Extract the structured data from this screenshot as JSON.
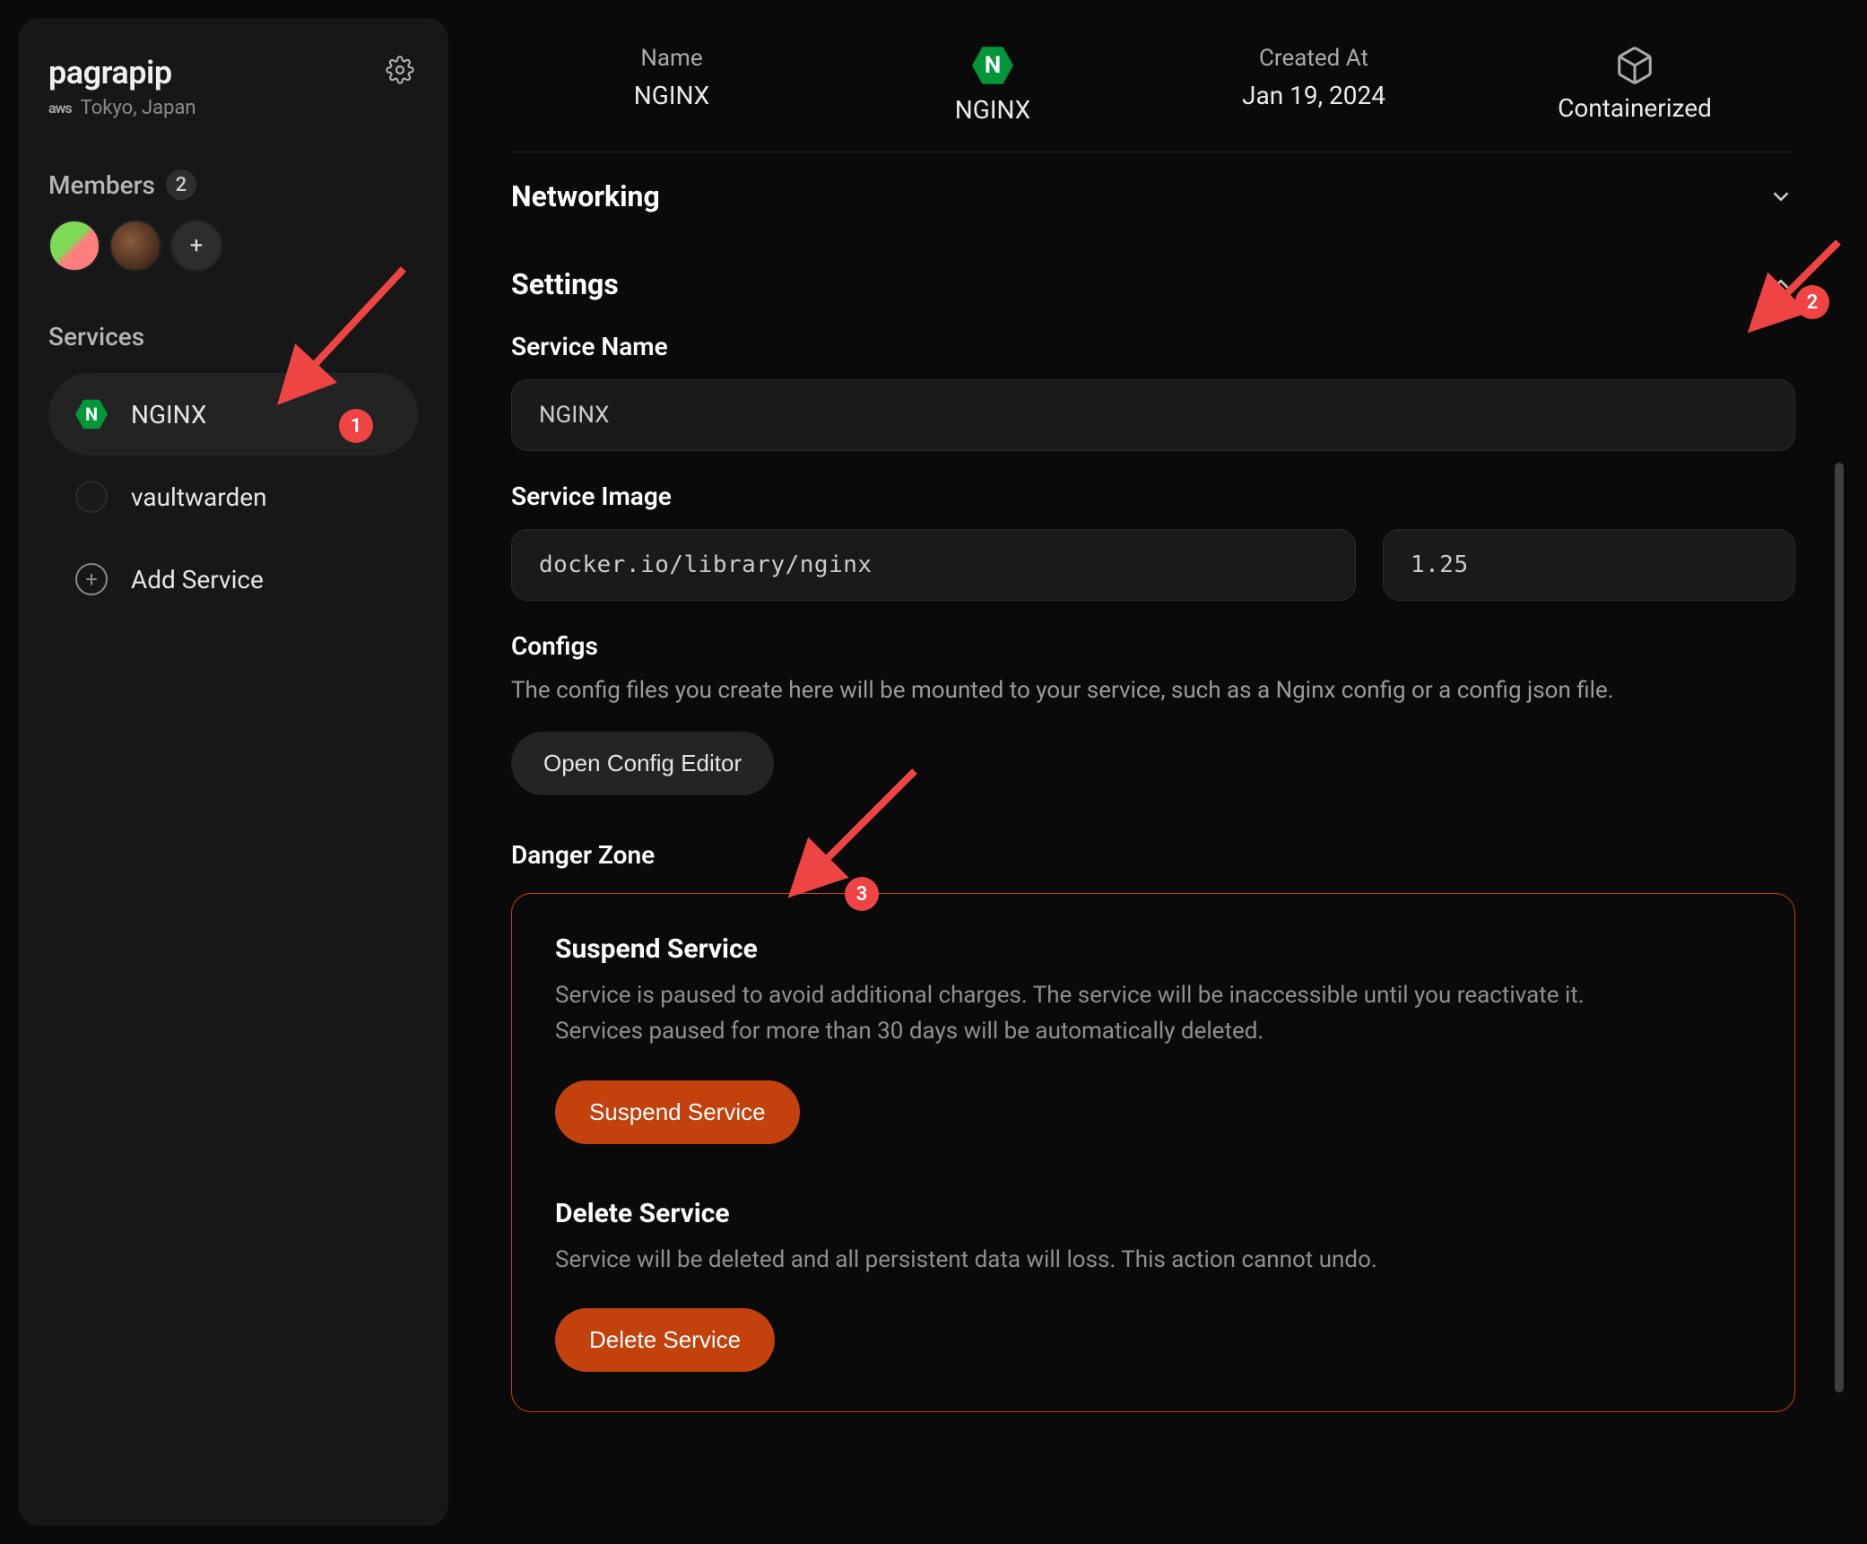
{
  "sidebar": {
    "project": "pagrapip",
    "provider": "aws",
    "region": "Tokyo, Japan",
    "members_label": "Members",
    "members_count": "2",
    "services_label": "Services",
    "items": [
      {
        "label": "NGINX"
      },
      {
        "label": "vaultwarden"
      }
    ],
    "add_service_label": "Add Service"
  },
  "header": {
    "name_label": "Name",
    "name_value": "NGINX",
    "type_value": "NGINX",
    "created_label": "Created At",
    "created_value": "Jan 19, 2024",
    "deploy_value": "Containerized"
  },
  "networking": {
    "title": "Networking"
  },
  "settings": {
    "title": "Settings",
    "service_name_label": "Service Name",
    "service_name_value": "NGINX",
    "service_image_label": "Service Image",
    "image_value": "docker.io/library/nginx",
    "image_version": "1.25",
    "configs_label": "Configs",
    "configs_desc": "The config files you create here will be mounted to your service, such as a Nginx config or a config json file.",
    "open_config_editor": "Open Config Editor",
    "danger_zone_label": "Danger Zone",
    "suspend_title": "Suspend Service",
    "suspend_desc": "Service is paused to avoid additional charges. The service will be inaccessible until you reactivate it. Services paused for more than 30 days will be automatically deleted.",
    "suspend_button": "Suspend Service",
    "delete_title": "Delete Service",
    "delete_desc": "Service will be deleted and all persistent data will loss. This action cannot undo.",
    "delete_button": "Delete Service"
  },
  "annotations": {
    "a1": "1",
    "a2": "2",
    "a3": "3"
  }
}
